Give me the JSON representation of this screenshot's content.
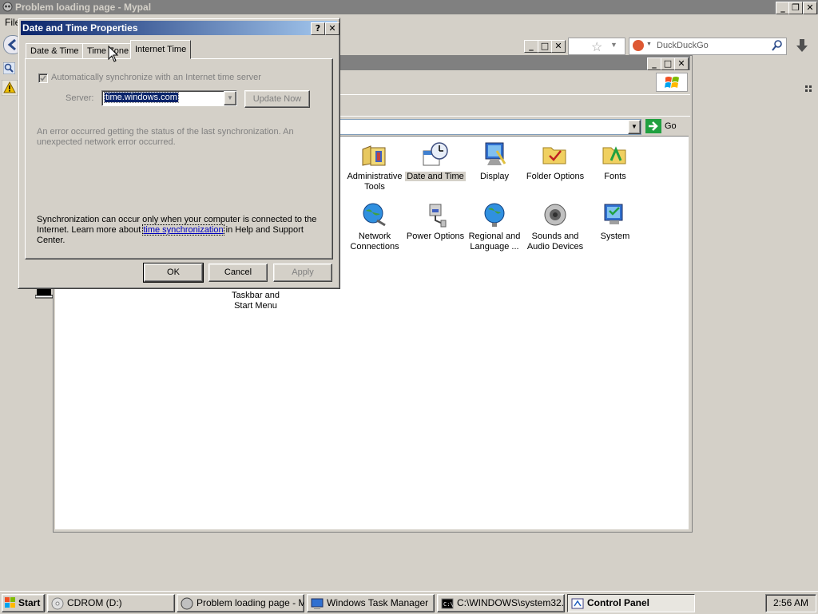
{
  "browser": {
    "title": "Problem loading page - Mypal",
    "menu_file": "File",
    "search_placeholder": "DuckDuckGo"
  },
  "control_panel": {
    "go_label": "Go",
    "items": [
      {
        "label": "Administrative Tools",
        "icon": "admin-tools-icon"
      },
      {
        "label": "Date and Time",
        "icon": "date-time-icon"
      },
      {
        "label": "Display",
        "icon": "display-icon"
      },
      {
        "label": "Folder Options",
        "icon": "folder-options-icon"
      },
      {
        "label": "Fonts",
        "icon": "fonts-icon"
      },
      {
        "label": "Network Connections",
        "icon": "network-icon"
      },
      {
        "label": "Power Options",
        "icon": "power-icon"
      },
      {
        "label": "Regional and Language ...",
        "icon": "regional-icon"
      },
      {
        "label": "Sounds and Audio Devices",
        "icon": "sounds-icon"
      },
      {
        "label": "System",
        "icon": "system-icon"
      },
      {
        "label": "Taskbar and Start Menu",
        "icon": "taskbar-icon"
      }
    ]
  },
  "dialog": {
    "title": "Date and Time Properties",
    "tabs": [
      "Date & Time",
      "Time Zone",
      "Internet Time"
    ],
    "sync_label": "Automatically synchronize with an Internet time server",
    "server_label": "Server:",
    "server_value": "time.windows.com",
    "update_now": "Update Now",
    "error_text": "An error occurred getting the status of the last synchronization.  An unexpected network error occurred.",
    "info_before": "Synchronization can occur only when your computer is connected to the Internet.  Learn more about ",
    "info_link": "time synchronization",
    "info_after": " in Help and Support Center.",
    "ok": "OK",
    "cancel": "Cancel",
    "apply": "Apply"
  },
  "taskbar": {
    "start": "Start",
    "buttons": [
      "CDROM (D:)",
      "Problem loading page - M...",
      "Windows Task Manager",
      "C:\\WINDOWS\\system32...",
      "Control Panel"
    ],
    "clock": "2:56 AM"
  }
}
